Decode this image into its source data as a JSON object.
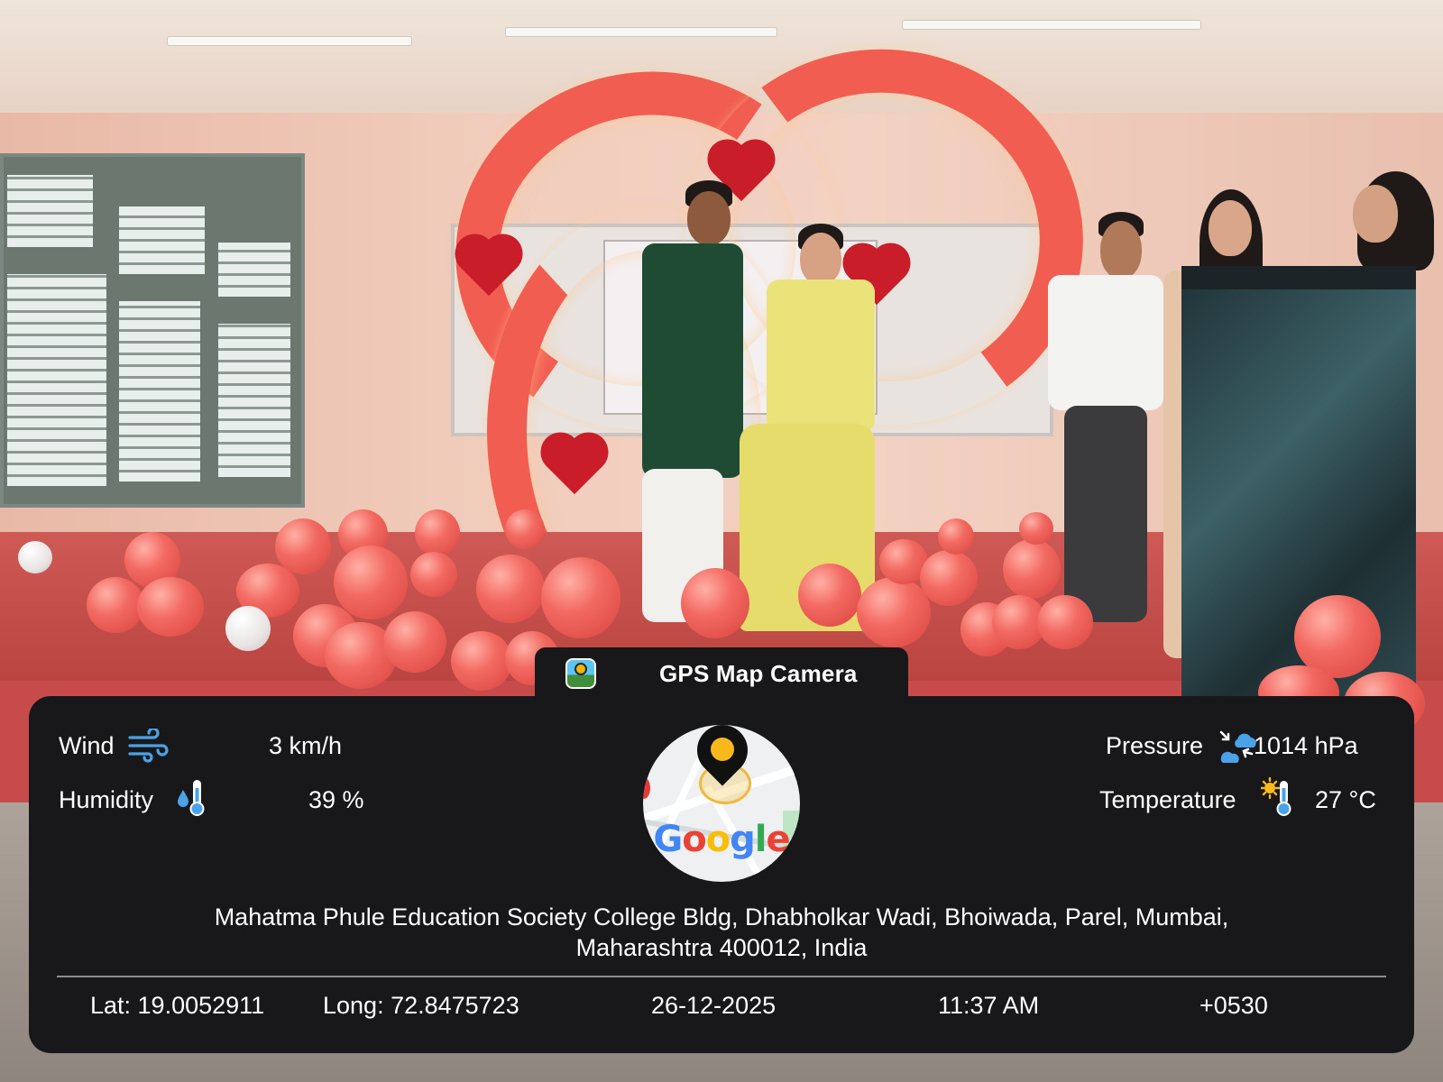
{
  "app": {
    "title": "GPS Map Camera"
  },
  "weather": {
    "wind_label": "Wind",
    "wind_value": "3 km/h",
    "humidity_label": "Humidity",
    "humidity_value": "39 %",
    "pressure_label": "Pressure",
    "pressure_value": "1014 hPa",
    "temperature_label": "Temperature",
    "temperature_value": "27 °C"
  },
  "map": {
    "logo_letters": [
      "G",
      "o",
      "o",
      "g",
      "l",
      "e"
    ],
    "logo_colors": [
      "#4285F4",
      "#EA4335",
      "#FBBC05",
      "#4285F4",
      "#34A853",
      "#EA4335"
    ]
  },
  "location": {
    "address_line1": "Mahatma Phule Education Society College Bldg, Dhabholkar Wadi, Bhoiwada, Parel, Mumbai,",
    "address_line2": "Maharashtra 400012, India",
    "lat": "Lat: 19.0052911",
    "long": "Long: 72.8475723",
    "date": "26-12-2025",
    "time": "11:37 AM",
    "timezone": "+0530"
  },
  "icons": {
    "wind": "wind-icon",
    "humidity": "humidity-thermometer-icon",
    "pressure": "pressure-cloud-icon",
    "temperature": "sun-thermometer-icon",
    "app": "gps-map-camera-app-icon",
    "pin": "map-pin-icon"
  },
  "colors": {
    "panel_bg": "#18181a",
    "icon_blue": "#4aa3e8",
    "pin_yellow": "#f9b81b"
  }
}
